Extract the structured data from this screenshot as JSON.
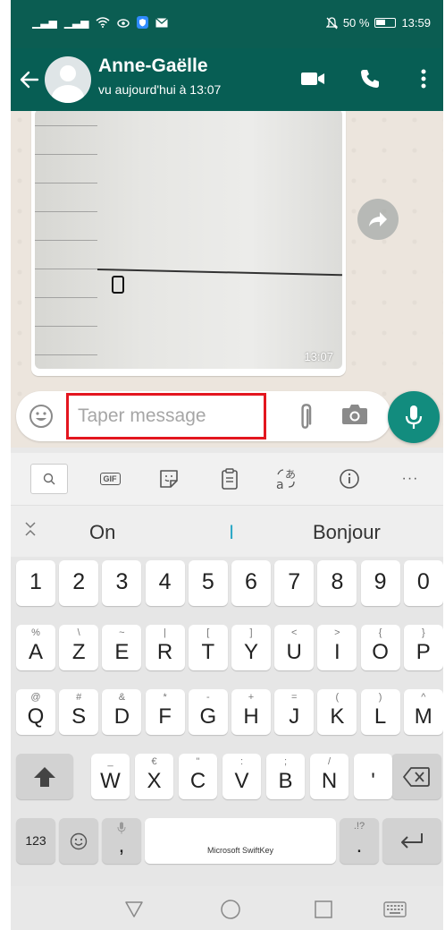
{
  "status_bar": {
    "battery": "50 %",
    "time": "13:59"
  },
  "header": {
    "contact_name": "Anne-Gaëlle",
    "contact_status": "vu aujourd'hui à 13:07"
  },
  "message": {
    "time": "13:07"
  },
  "composer": {
    "placeholder": "Taper message"
  },
  "suggestions": {
    "left": "On",
    "middle": "I",
    "right": "Bonjour"
  },
  "toolbar": {
    "gif": "GIF",
    "more": "···"
  },
  "keyboard": {
    "numbers": [
      "1",
      "2",
      "3",
      "4",
      "5",
      "6",
      "7",
      "8",
      "9",
      "0"
    ],
    "row1": [
      {
        "main": "A",
        "sec": "%"
      },
      {
        "main": "Z",
        "sec": "\\"
      },
      {
        "main": "E",
        "sec": "~"
      },
      {
        "main": "R",
        "sec": "|"
      },
      {
        "main": "T",
        "sec": "["
      },
      {
        "main": "Y",
        "sec": "]"
      },
      {
        "main": "U",
        "sec": "<"
      },
      {
        "main": "I",
        "sec": ">"
      },
      {
        "main": "O",
        "sec": "{"
      },
      {
        "main": "P",
        "sec": "}"
      }
    ],
    "row2": [
      {
        "main": "Q",
        "sec": "@"
      },
      {
        "main": "S",
        "sec": "#"
      },
      {
        "main": "D",
        "sec": "&"
      },
      {
        "main": "F",
        "sec": "*"
      },
      {
        "main": "G",
        "sec": "-"
      },
      {
        "main": "H",
        "sec": "+"
      },
      {
        "main": "J",
        "sec": "="
      },
      {
        "main": "K",
        "sec": "("
      },
      {
        "main": "L",
        "sec": ")"
      },
      {
        "main": "M",
        "sec": "^"
      }
    ],
    "row3": [
      {
        "main": "W",
        "sec": "_"
      },
      {
        "main": "X",
        "sec": "€"
      },
      {
        "main": "C",
        "sec": "\""
      },
      {
        "main": "V",
        "sec": ":"
      },
      {
        "main": "B",
        "sec": ";"
      },
      {
        "main": "N",
        "sec": "/"
      },
      {
        "main": "'",
        "sec": ""
      }
    ],
    "num_switch": "123",
    "comma": ",",
    "space_label": "Microsoft SwiftKey",
    "period": ".",
    "period_sec": ".!?"
  },
  "colors": {
    "header": "#075e54",
    "accent": "#128c7e",
    "highlight": "#e3161f"
  }
}
